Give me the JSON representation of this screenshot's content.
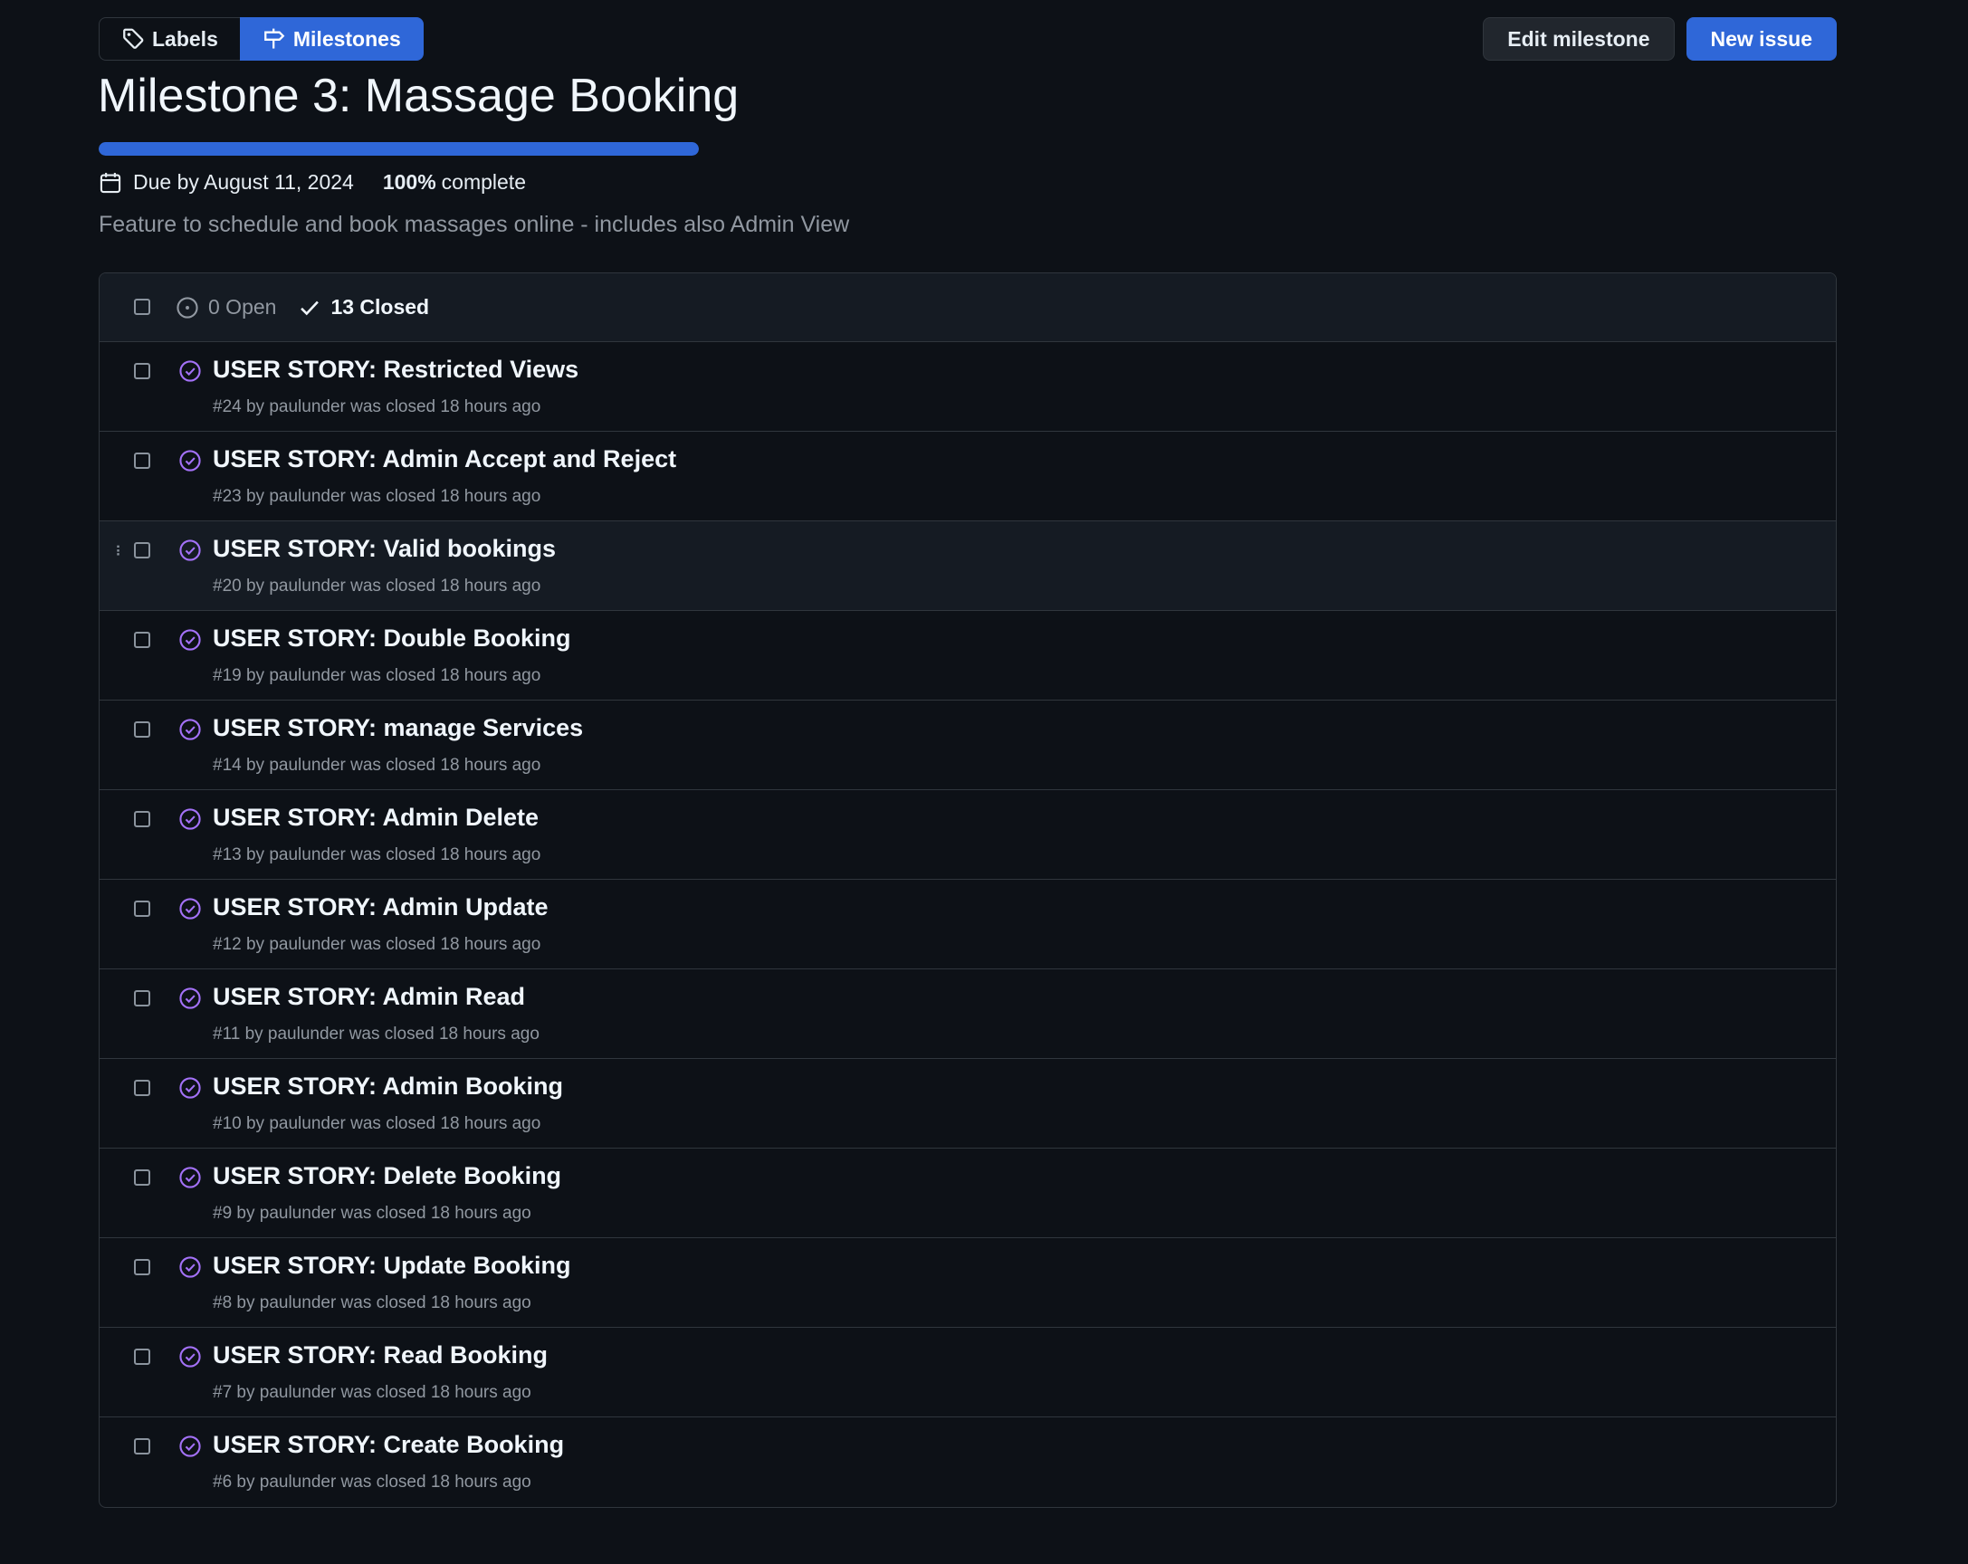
{
  "subnav": {
    "labels": "Labels",
    "milestones": "Milestones"
  },
  "actions": {
    "edit_milestone": "Edit milestone",
    "new_issue": "New issue"
  },
  "milestone": {
    "title": "Milestone 3: Massage Booking",
    "progress_fraction": 1.0,
    "due": "Due by August 11, 2024",
    "percent": "100%",
    "percent_label": "complete",
    "description": "Feature to schedule and book massages online - includes also Admin View"
  },
  "states": {
    "open": "0 Open",
    "closed": "13 Closed"
  },
  "colors": {
    "accent": "#2f67d8",
    "closed_icon": "#a371f7"
  },
  "issues": [
    {
      "title": "USER STORY: Restricted Views",
      "meta": "#24 by paulunder was closed 18 hours ago"
    },
    {
      "title": "USER STORY: Admin Accept and Reject",
      "meta": "#23 by paulunder was closed 18 hours ago"
    },
    {
      "title": "USER STORY: Valid bookings",
      "meta": "#20 by paulunder was closed 18 hours ago"
    },
    {
      "title": "USER STORY: Double Booking",
      "meta": "#19 by paulunder was closed 18 hours ago"
    },
    {
      "title": "USER STORY: manage Services",
      "meta": "#14 by paulunder was closed 18 hours ago"
    },
    {
      "title": "USER STORY: Admin Delete",
      "meta": "#13 by paulunder was closed 18 hours ago"
    },
    {
      "title": "USER STORY: Admin Update",
      "meta": "#12 by paulunder was closed 18 hours ago"
    },
    {
      "title": "USER STORY: Admin Read",
      "meta": "#11 by paulunder was closed 18 hours ago"
    },
    {
      "title": "USER STORY: Admin Booking",
      "meta": "#10 by paulunder was closed 18 hours ago"
    },
    {
      "title": "USER STORY: Delete Booking",
      "meta": "#9 by paulunder was closed 18 hours ago"
    },
    {
      "title": "USER STORY: Update Booking",
      "meta": "#8 by paulunder was closed 18 hours ago"
    },
    {
      "title": "USER STORY: Read Booking",
      "meta": "#7 by paulunder was closed 18 hours ago"
    },
    {
      "title": "USER STORY: Create Booking",
      "meta": "#6 by paulunder was closed 18 hours ago"
    }
  ]
}
